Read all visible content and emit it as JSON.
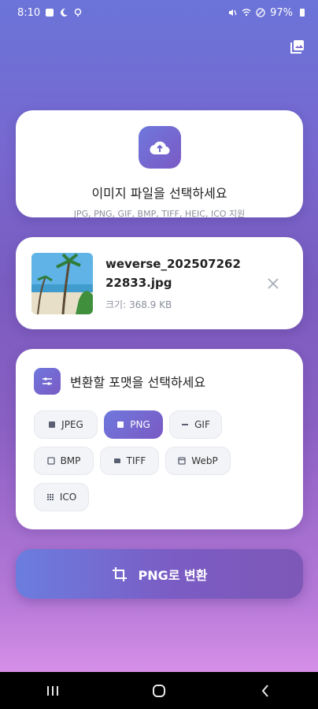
{
  "status": {
    "time": "8:10",
    "battery": "97%"
  },
  "upload": {
    "title": "이미지 파일을 선택하세요",
    "subtitle": "JPG, PNG, GIF, BMP, TIFF, HEIC, ICO 지원"
  },
  "file": {
    "name": "weverse_20250726222833.jpg",
    "size": "크기: 368.9 KB"
  },
  "format": {
    "title": "변환할 포맷을 선택하세요",
    "options": [
      "JPEG",
      "PNG",
      "GIF",
      "BMP",
      "TIFF",
      "WebP",
      "ICO"
    ],
    "selected": "PNG"
  },
  "convert": {
    "label": "PNG로 변환"
  },
  "colors": {
    "accent": "#6f78dd",
    "accent2": "#7a5ac4"
  }
}
